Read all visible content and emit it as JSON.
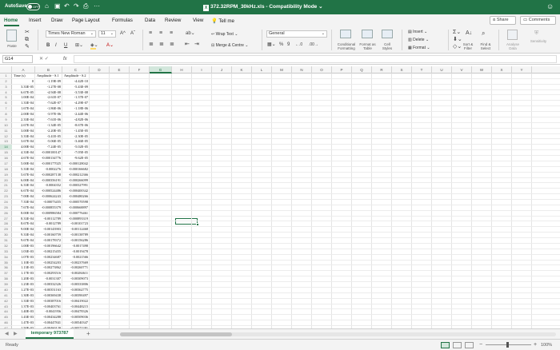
{
  "titlebar": {
    "autosave_label": "AutoSave",
    "autosave_state": "OFF",
    "document_title": "372.32RPM_30kHz.xls - Compatibility Mode",
    "icons": [
      "home-icon",
      "save-icon",
      "undo-icon",
      "redo-icon",
      "print-icon",
      "more-icon"
    ]
  },
  "tabs": [
    "Home",
    "Insert",
    "Draw",
    "Page Layout",
    "Formulas",
    "Data",
    "Review",
    "View"
  ],
  "tell_me": "Tell me",
  "share_label": "Share",
  "comments_label": "Comments",
  "ribbon": {
    "paste_label": "Paste",
    "font_name": "Times New Roman",
    "font_size": "11",
    "bold": "B",
    "italic": "I",
    "underline": "U",
    "wrap_text": "Wrap Text",
    "merge_center": "Merge & Centre",
    "number_format": "General",
    "percent": "%",
    "comma": "9",
    "conditional_formatting": "Conditional Formatting",
    "format_as_table": "Format as Table",
    "cell_styles": "Cell Styles",
    "insert": "Insert",
    "delete": "Delete",
    "format": "Format",
    "sort_filter": "Sort & Filter",
    "find_select": "Find & Select",
    "analyse_data": "Analyse Data",
    "sensitivity": "Sensitivity",
    "font_color": "#c00000",
    "fill_color": "#ffd966"
  },
  "formula_bar": {
    "name_box": "G14",
    "fx": "fx",
    "value": ""
  },
  "columns": [
    "A",
    "B",
    "C",
    "D",
    "E",
    "F",
    "G",
    "H",
    "I",
    "J",
    "K",
    "L",
    "M",
    "N",
    "O",
    "P",
    "Q",
    "R",
    "S",
    "T",
    "U",
    "V",
    "W",
    "X",
    "Y"
  ],
  "selected_column": "G",
  "selected_row": "14",
  "rows": [
    [
      "Time (s)",
      "Amplitude - S.1",
      "Amplitude - S.2"
    ],
    [
      "0",
      "-1.19E-09",
      "-4.42E-10"
    ],
    [
      "3.33E-05",
      "-1.27E-08",
      "-5.43E-09"
    ],
    [
      "6.67E-05",
      "-4.94E-08",
      "-3.53E-08"
    ],
    [
      "1.00E-04",
      "-2.61E-07",
      "-1.37E-07"
    ],
    [
      "1.33E-04",
      "-7.62E-07",
      "-4.29E-07"
    ],
    [
      "1.67E-04",
      "-1.86E-06",
      "-1.18E-06"
    ],
    [
      "2.00E-04",
      "-3.97E-06",
      "-2.44E-06"
    ],
    [
      "2.33E-04",
      "-7.61E-06",
      "-4.82E-06"
    ],
    [
      "2.67E-04",
      "-1.34E-05",
      "-8.67E-06"
    ],
    [
      "3.00E-04",
      "-2.20E-05",
      "-1.45E-05"
    ],
    [
      "3.33E-04",
      "-3.41E-05",
      "-2.30E-05"
    ],
    [
      "3.67E-04",
      "-5.06E-05",
      "-3.46E-05"
    ],
    [
      "4.00E-04",
      "-7.24E-05",
      "-5.02E-05"
    ],
    [
      "4.33E-04",
      "-0.000100147",
      "-7.05E-05"
    ],
    [
      "4.67E-04",
      "-0.000134776",
      "-9.62E-05"
    ],
    [
      "5.00E-04",
      "-0.000177025",
      "-0.000128042"
    ],
    [
      "5.33E-04",
      "-0.0002276",
      "-0.000166682"
    ],
    [
      "5.67E-04",
      "-0.000287138",
      "-0.000212366"
    ],
    [
      "6.00E-04",
      "-0.000356191",
      "-0.000266099"
    ],
    [
      "6.33E-04",
      "-0.0004352",
      "-0.000327991"
    ],
    [
      "6.67E-04",
      "-0.000524486",
      "-0.000400342"
    ],
    [
      "7.00E-04",
      "-0.000624243",
      "-0.000480266"
    ],
    [
      "7.33E-04",
      "-0.00073455",
      "-0.000570598"
    ],
    [
      "7.67E-04",
      "-0.000855379",
      "-0.000668897"
    ],
    [
      "8.00E-04",
      "-0.000986584",
      "-0.000776461"
    ],
    [
      "8.33E-04",
      "-0.00112789",
      "-0.000893319"
    ],
    [
      "8.67E-04",
      "-0.0012789",
      "-0.00101723"
    ],
    [
      "9.00E-04",
      "-0.00143903",
      "-0.00112468"
    ],
    [
      "9.33E-04",
      "-0.00160759",
      "-0.00138789"
    ],
    [
      "9.67E-04",
      "-0.00178372",
      "-0.00156286"
    ],
    [
      "1.00E-03",
      "-0.00196642",
      "-0.0017498"
    ],
    [
      "1.03E-03",
      "-0.00215455",
      "-0.0019478"
    ],
    [
      "1.07E-03",
      "-0.00234687",
      "-0.0021566"
    ],
    [
      "1.10E-03",
      "-0.00254203",
      "-0.00237669"
    ],
    [
      "1.13E-03",
      "-0.00273862",
      "-0.00260771"
    ],
    [
      "1.17E-03",
      "-0.00293516",
      "-0.00284611"
    ],
    [
      "1.20E-03",
      "-0.0031307",
      "-0.00309073"
    ],
    [
      "1.23E-03",
      "-0.00332326",
      "-0.00333806"
    ],
    [
      "1.27E-03",
      "-0.00351163",
      "-0.00362775"
    ],
    [
      "1.30E-03",
      "-0.00369438",
      "-0.00390497"
    ],
    [
      "1.33E-03",
      "-0.00387016",
      "-0.00419022"
    ],
    [
      "1.37E-03",
      "-0.00403761",
      "-0.00448215"
    ],
    [
      "1.40E-03",
      "-0.0041956",
      "-0.00478326"
    ],
    [
      "1.43E-03",
      "-0.00434288",
      "-0.00509036"
    ],
    [
      "1.47E-03",
      "-0.00447841",
      "-0.00540347"
    ],
    [
      "1.50E-03",
      "-0.00460128",
      "-0.00572281"
    ]
  ],
  "sheet_tab": "temporary 973787",
  "status": "Ready",
  "zoom": "100%"
}
